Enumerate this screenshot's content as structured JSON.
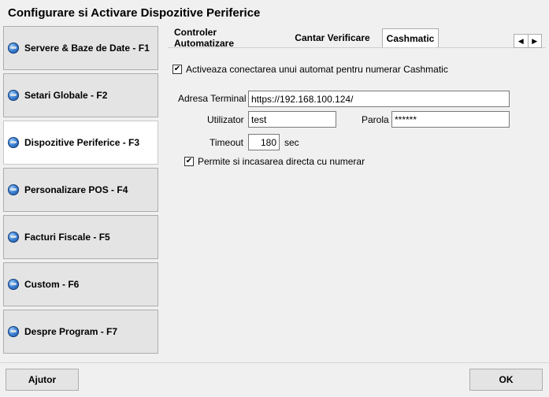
{
  "window": {
    "title": "Configurare si Activare Dispozitive Periferice"
  },
  "sidebar": {
    "items": [
      {
        "label": "Servere & Baze de Date - F1",
        "icon": "globe-icon"
      },
      {
        "label": "Setari Globale - F2",
        "icon": "globe-icon"
      },
      {
        "label": "Dispozitive Periferice - F3",
        "icon": "globe-icon",
        "active": true
      },
      {
        "label": "Personalizare POS - F4",
        "icon": "globe-icon"
      },
      {
        "label": "Facturi Fiscale - F5",
        "icon": "globe-icon"
      },
      {
        "label": "Custom - F6",
        "icon": "globe-icon"
      },
      {
        "label": "Despre Program - F7",
        "icon": "globe-icon"
      }
    ]
  },
  "tabs": [
    {
      "label": "Controler Automatizare"
    },
    {
      "label": "Cantar Verificare"
    },
    {
      "label": "Cashmatic",
      "active": true
    }
  ],
  "tab_arrows": {
    "left": "◀",
    "right": "▶"
  },
  "form": {
    "enable_check": {
      "checked": true,
      "mark": "✔",
      "label": "Activeaza conectarea unui automat pentru numerar Cashmatic"
    },
    "address": {
      "label": "Adresa Terminal",
      "value": "https://192.168.100.124/"
    },
    "user": {
      "label": "Utilizator",
      "value": "test"
    },
    "password": {
      "label": "Parola",
      "value": "******"
    },
    "timeout": {
      "label": "Timeout",
      "value": "180",
      "unit": "sec"
    },
    "direct_check": {
      "checked": true,
      "mark": "✔",
      "label": "Permite si incasarea directa cu numerar"
    }
  },
  "footer": {
    "help_label": "Ajutor",
    "ok_label": "OK"
  }
}
